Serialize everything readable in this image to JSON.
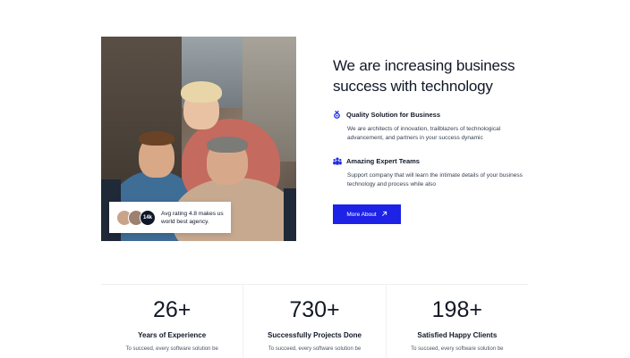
{
  "rating": {
    "avatar_count": "14k",
    "text": "Avg rating 4.8 makes us world best agency."
  },
  "headline": "We are increasing business success with technology",
  "features": [
    {
      "icon": "medal-icon",
      "title": "Quality Solution for Business",
      "description": "We are architects of innovation, trailblazers of technological advancement, and partners in your success dynamic"
    },
    {
      "icon": "team-icon",
      "title": "Amazing Expert Teams",
      "description": "Support company that will learn the intimate details of your business technology and process while also"
    }
  ],
  "cta": {
    "label": "More About",
    "icon": "arrow-up-right-icon"
  },
  "stats": [
    {
      "number": "26+",
      "label": "Years of Experience",
      "description": "To succeed, every software solution be"
    },
    {
      "number": "730+",
      "label": "Successfully Projects Done",
      "description": "To succeed, every software solution be"
    },
    {
      "number": "198+",
      "label": "Satisfied Happy Clients",
      "description": "To succeed, every software solution be"
    }
  ],
  "colors": {
    "accent": "#1d22e6",
    "text": "#111827"
  }
}
